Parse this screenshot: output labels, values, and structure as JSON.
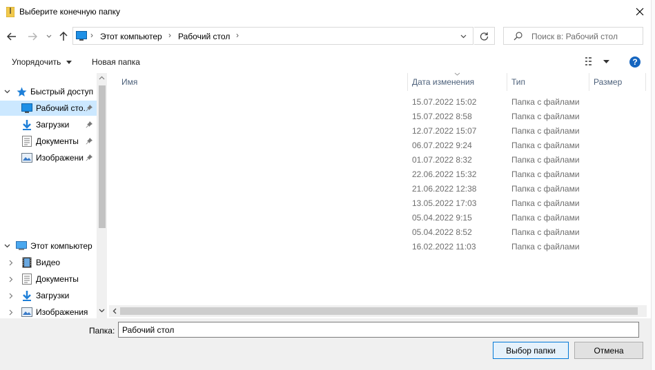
{
  "window": {
    "title": "Выберите конечную папку"
  },
  "nav": {
    "breadcrumb": [
      "Этот компьютер",
      "Рабочий стол"
    ],
    "search_placeholder": "Поиск в: Рабочий стол"
  },
  "commands": {
    "organize": "Упорядочить",
    "new_folder": "Новая папка"
  },
  "sidebar": {
    "quick_access": "Быстрый доступ",
    "quick_items": [
      {
        "label": "Рабочий сто.",
        "icon": "desktop-icon",
        "pinned": true
      },
      {
        "label": "Загрузки",
        "icon": "download-icon",
        "pinned": true
      },
      {
        "label": "Документы",
        "icon": "document-icon",
        "pinned": true
      },
      {
        "label": "Изображени",
        "icon": "image-icon",
        "pinned": true
      }
    ],
    "this_pc": "Этот компьютер",
    "pc_items": [
      {
        "label": "Видео",
        "icon": "video-icon"
      },
      {
        "label": "Документы",
        "icon": "document-icon"
      },
      {
        "label": "Загрузки",
        "icon": "download-icon"
      },
      {
        "label": "Изображения",
        "icon": "image-icon"
      }
    ]
  },
  "columns": {
    "name": "Имя",
    "date": "Дата изменения",
    "type": "Тип",
    "size": "Размер"
  },
  "rows": [
    {
      "date": "15.07.2022 15:02",
      "type": "Папка с файлами"
    },
    {
      "date": "15.07.2022 8:58",
      "type": "Папка с файлами"
    },
    {
      "date": "12.07.2022 15:07",
      "type": "Папка с файлами"
    },
    {
      "date": "06.07.2022 9:24",
      "type": "Папка с файлами"
    },
    {
      "date": "01.07.2022 8:32",
      "type": "Папка с файлами"
    },
    {
      "date": "22.06.2022 15:32",
      "type": "Папка с файлами"
    },
    {
      "date": "21.06.2022 12:38",
      "type": "Папка с файлами"
    },
    {
      "date": "13.05.2022 17:03",
      "type": "Папка с файлами"
    },
    {
      "date": "05.04.2022 9:15",
      "type": "Папка с файлами"
    },
    {
      "date": "05.04.2022 8:52",
      "type": "Папка с файлами"
    },
    {
      "date": "16.02.2022 11:03",
      "type": "Папка с файлами"
    }
  ],
  "footer": {
    "folder_label": "Папка:",
    "folder_value": "Рабочий стол",
    "select_button": "Выбор папки",
    "cancel_button": "Отмена"
  },
  "colors": {
    "accent": "#0078d7",
    "selection": "#cce8ff",
    "help": "#1565c0"
  }
}
